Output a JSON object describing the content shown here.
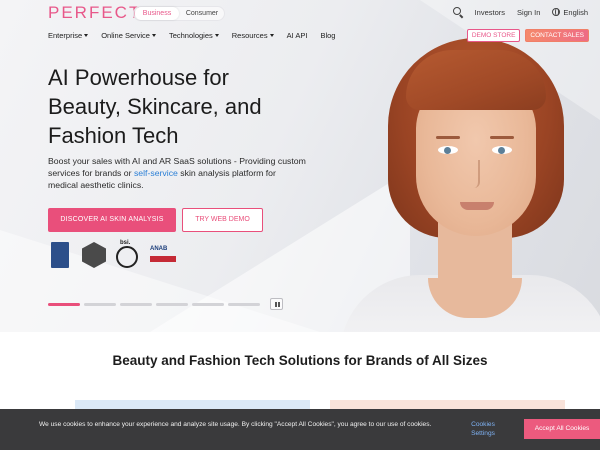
{
  "brand": {
    "logo_text": "PERFECT",
    "accent": "#e94f7b"
  },
  "segment": {
    "business": "Business",
    "consumer": "Consumer",
    "selected": "Business"
  },
  "top_links": {
    "investors": "Investors",
    "sign_in": "Sign In",
    "language": "English"
  },
  "nav": {
    "items": [
      {
        "label": "Enterprise",
        "has_caret": true
      },
      {
        "label": "Online Service",
        "has_caret": true
      },
      {
        "label": "Technologies",
        "has_caret": true
      },
      {
        "label": "Resources",
        "has_caret": true
      },
      {
        "label": "AI API",
        "has_caret": false
      },
      {
        "label": "Blog",
        "has_caret": false
      }
    ],
    "demo_store": "DEMO STORE",
    "contact_sales": "CONTACT SALES"
  },
  "hero": {
    "headline": [
      "AI Powerhouse for",
      "Beauty, Skincare, and",
      "Fashion Tech"
    ],
    "sub_before": "Boost your sales with AI and AR SaaS solutions - Providing custom services for brands or ",
    "sub_link": "self-service",
    "sub_after": " skin analysis platform for medical aesthetic clinics.",
    "cta_primary": "DISCOVER AI SKIN ANALYSIS",
    "cta_secondary": "TRY WEB DEMO",
    "badges": [
      {
        "name": "fda-badge",
        "text": ""
      },
      {
        "name": "hex-certification-badge",
        "text": ""
      },
      {
        "name": "bsi-badge",
        "text": "bsi."
      },
      {
        "name": "anab-badge",
        "text": "ANAB"
      }
    ],
    "slides": {
      "count": 6,
      "active_index": 0
    }
  },
  "section": {
    "title": "Beauty and Fashion Tech Solutions for Brands of All Sizes"
  },
  "cookie": {
    "text": "We use cookies to enhance your experience and analyze site usage. By clicking \"Accept All Cookies\", you agree to our use of cookies.",
    "settings": "Cookies Settings",
    "accept": "Accept All Cookies"
  }
}
